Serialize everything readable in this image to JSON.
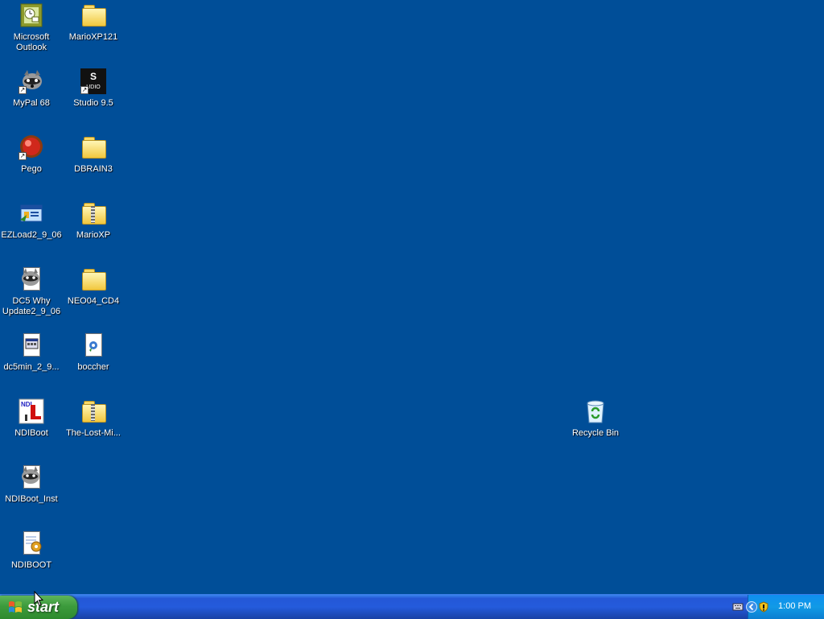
{
  "desktop_icons": [
    {
      "label": "Microsoft Outlook",
      "line1": "Microsoft",
      "line2": "Outlook",
      "icon": "outlook-icon"
    },
    {
      "label": "MarioXP121",
      "icon": "folder-icon"
    },
    {
      "label": "MyPal 68",
      "icon": "raccoon-shortcut-icon"
    },
    {
      "label": "Studio 9.5",
      "icon": "studio-shortcut-icon"
    },
    {
      "label": "Pego",
      "icon": "red-ball-shortcut-icon"
    },
    {
      "label": "DBRAIN3",
      "icon": "folder-icon"
    },
    {
      "label": "EZLoad2_9_06",
      "icon": "ezload-window-icon"
    },
    {
      "label": "MarioXP",
      "icon": "zip-folder-icon"
    },
    {
      "label": "DC5 Why Update2_9_06",
      "line1": "DC5 Why",
      "line2": "Update2_9_06",
      "icon": "raccoon-document-icon"
    },
    {
      "label": "NEO04_CD4",
      "icon": "folder-icon"
    },
    {
      "label": "dc5min_2_9...",
      "icon": "application-document-icon"
    },
    {
      "label": "boccher",
      "icon": "media-document-icon"
    },
    {
      "label": "NDIBoot",
      "icon": "ndiboot-icon"
    },
    {
      "label": "The-Lost-Mi...",
      "icon": "zip-folder-icon"
    },
    {
      "label": "NDIBoot_Inst",
      "icon": "raccoon-document-icon"
    },
    {
      "label": "NDIBOOT",
      "icon": "notepad-gear-icon"
    },
    {
      "label": "Recycle Bin",
      "icon": "recycle-bin-icon"
    }
  ],
  "taskbar": {
    "start_label": "start",
    "clock": "1:00 PM",
    "tray_icons": [
      "keyboard-icon",
      "show-hidden-icons-icon",
      "security-shield-icon"
    ]
  },
  "colors": {
    "desktop_background": "#004E98",
    "taskbar_blue": "#245BDC",
    "start_green": "#3C9B3C"
  }
}
